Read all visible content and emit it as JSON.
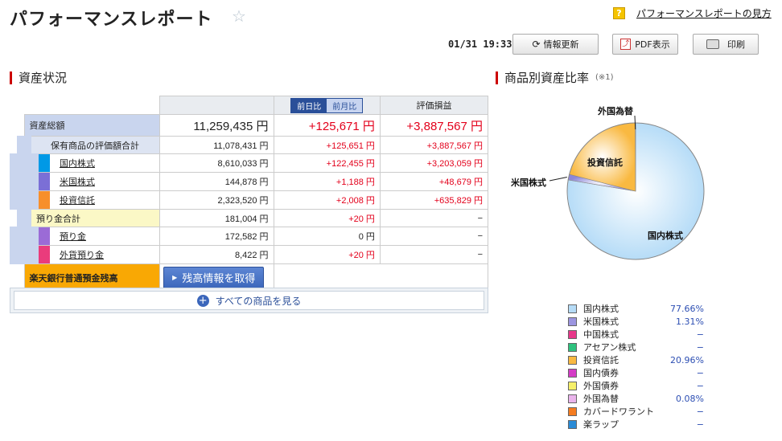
{
  "header": {
    "title": "パフォーマンスレポート",
    "help_link": "パフォーマンスレポートの見方",
    "timestamp": "01/31 19:33",
    "refresh_label": "情報更新",
    "pdf_label": "PDF表示",
    "print_label": "印刷"
  },
  "asset_section": {
    "title": "資産状況",
    "tabs": [
      "前日比",
      "前月比"
    ],
    "col_valuation": "評価損益",
    "total": {
      "label": "資産総額",
      "amount": "11,259,435 円",
      "change": "+125,671 円",
      "pl": "+3,887,567 円"
    },
    "holdings": {
      "label": "保有商品の評価額合計",
      "amount": "11,078,431 円",
      "change": "+125,651 円",
      "pl": "+3,887,567 円"
    },
    "holding_items": [
      {
        "label": "国内株式",
        "amount": "8,610,033 円",
        "change": "+122,455 円",
        "pl": "+3,203,059 円",
        "color": "#0099e6"
      },
      {
        "label": "米国株式",
        "amount": "144,878 円",
        "change": "+1,188 円",
        "pl": "+48,679 円",
        "color": "#7b6fd6"
      },
      {
        "label": "投資信託",
        "amount": "2,323,520 円",
        "change": "+2,008 円",
        "pl": "+635,829 円",
        "color": "#f78f2b"
      }
    ],
    "deposits": {
      "label": "預り金合計",
      "amount": "181,004 円",
      "change": "+20 円",
      "pl": "−"
    },
    "deposit_items": [
      {
        "label": "預り金",
        "amount": "172,582 円",
        "change": "0 円",
        "pl": "−",
        "color": "#9b6bd6"
      },
      {
        "label": "外貨預り金",
        "amount": "8,422 円",
        "change": "+20 円",
        "pl": "−",
        "color": "#ea3c7c"
      }
    ],
    "bank": {
      "label": "楽天銀行普通預金残高",
      "button": "残高情報を取得"
    },
    "view_all": "すべての商品を見る"
  },
  "ratio_section": {
    "title": "商品別資産比率",
    "note": "(※1)"
  },
  "chart_data": {
    "type": "pie",
    "title": "",
    "slices": [
      {
        "name": "国内株式",
        "value": 77.66,
        "color": "#b6dcf7"
      },
      {
        "name": "米国株式",
        "value": 1.31,
        "color": "#8c86d8"
      },
      {
        "name": "投資信託",
        "value": 20.96,
        "color": "#f9b941"
      },
      {
        "name": "外国為替",
        "value": 0.08,
        "color": "#e8b0e0"
      }
    ]
  },
  "legend": [
    {
      "name": "国内株式",
      "value": "77.66%",
      "color": "#b6dcf7"
    },
    {
      "name": "米国株式",
      "value": "1.31%",
      "color": "#9c95e0"
    },
    {
      "name": "中国株式",
      "value": "−",
      "color": "#e8388a"
    },
    {
      "name": "アセアン株式",
      "value": "−",
      "color": "#2ec27e"
    },
    {
      "name": "投資信託",
      "value": "20.96%",
      "color": "#f9b941"
    },
    {
      "name": "国内債券",
      "value": "−",
      "color": "#d43cc6"
    },
    {
      "name": "外国債券",
      "value": "−",
      "color": "#f6f06a"
    },
    {
      "name": "外国為替",
      "value": "0.08%",
      "color": "#eab4ec"
    },
    {
      "name": "カバードワラント",
      "value": "−",
      "color": "#f57c20"
    },
    {
      "name": "楽ラップ",
      "value": "−",
      "color": "#2a8bd6"
    }
  ]
}
